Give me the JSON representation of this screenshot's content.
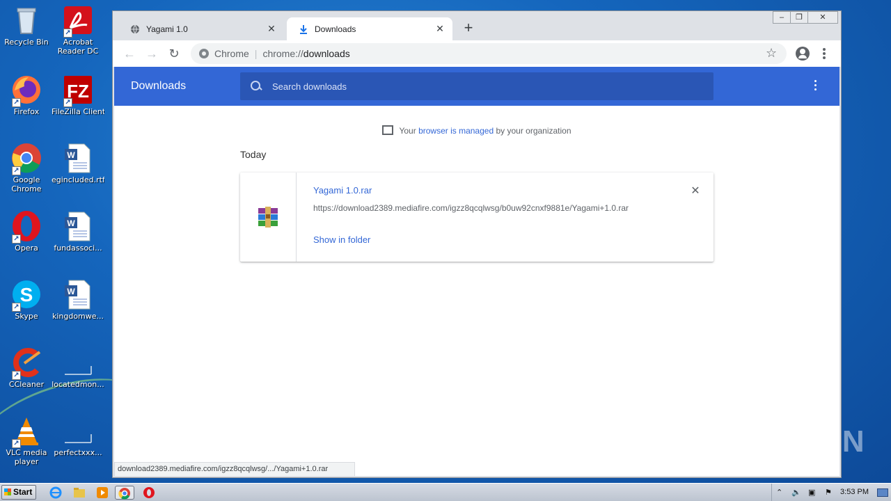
{
  "desktop": {
    "icons_col1": [
      {
        "label": "Recycle Bin",
        "icon": "recycle-bin-icon"
      },
      {
        "label": "Firefox",
        "icon": "firefox-icon"
      },
      {
        "label": "Google Chrome",
        "icon": "chrome-icon"
      },
      {
        "label": "Opera",
        "icon": "opera-icon"
      },
      {
        "label": "Skype",
        "icon": "skype-icon"
      },
      {
        "label": "CCleaner",
        "icon": "ccleaner-icon"
      },
      {
        "label": "VLC media player",
        "icon": "vlc-icon"
      }
    ],
    "icons_col2": [
      {
        "label": "Acrobat Reader DC",
        "icon": "acrobat-icon"
      },
      {
        "label": "FileZilla Client",
        "icon": "filezilla-icon"
      },
      {
        "label": "egincluded.rtf",
        "icon": "word-doc-icon"
      },
      {
        "label": "fundassoci...",
        "icon": "word-doc-icon"
      },
      {
        "label": "kingdomwe...",
        "icon": "word-doc-icon"
      },
      {
        "label": "locatedmon...",
        "icon": "blank-file-icon"
      },
      {
        "label": "perfectxxx...",
        "icon": "blank-file-icon"
      }
    ]
  },
  "browser": {
    "tabs": [
      {
        "title": "Yagami 1.0",
        "icon": "globe-icon",
        "active": false
      },
      {
        "title": "Downloads",
        "icon": "download-icon",
        "active": true
      }
    ],
    "new_tab": "+",
    "omnibox": {
      "chip": "Chrome",
      "scheme": "chrome://",
      "path": "downloads"
    },
    "status_url": "download2389.mediafire.com/igzz8qcqlwsg/.../Yagami+1.0.rar"
  },
  "downloads_page": {
    "title": "Downloads",
    "search_placeholder": "Search downloads",
    "managed": {
      "prefix": "Your ",
      "link": "browser is managed",
      "suffix": " by your organization"
    },
    "section": "Today",
    "items": [
      {
        "filename": "Yagami 1.0.rar",
        "url": "https://download2389.mediafire.com/igzz8qcqlwsg/b0uw92cnxf9881e/Yagami+1.0.rar",
        "action": "Show in folder"
      }
    ]
  },
  "watermark": "ANY RUN",
  "taskbar": {
    "start": "Start",
    "clock": "3:53 PM"
  },
  "colors": {
    "header_blue": "#3367d6",
    "link_blue": "#3367d6",
    "desktop_blue": "#1566bd"
  }
}
